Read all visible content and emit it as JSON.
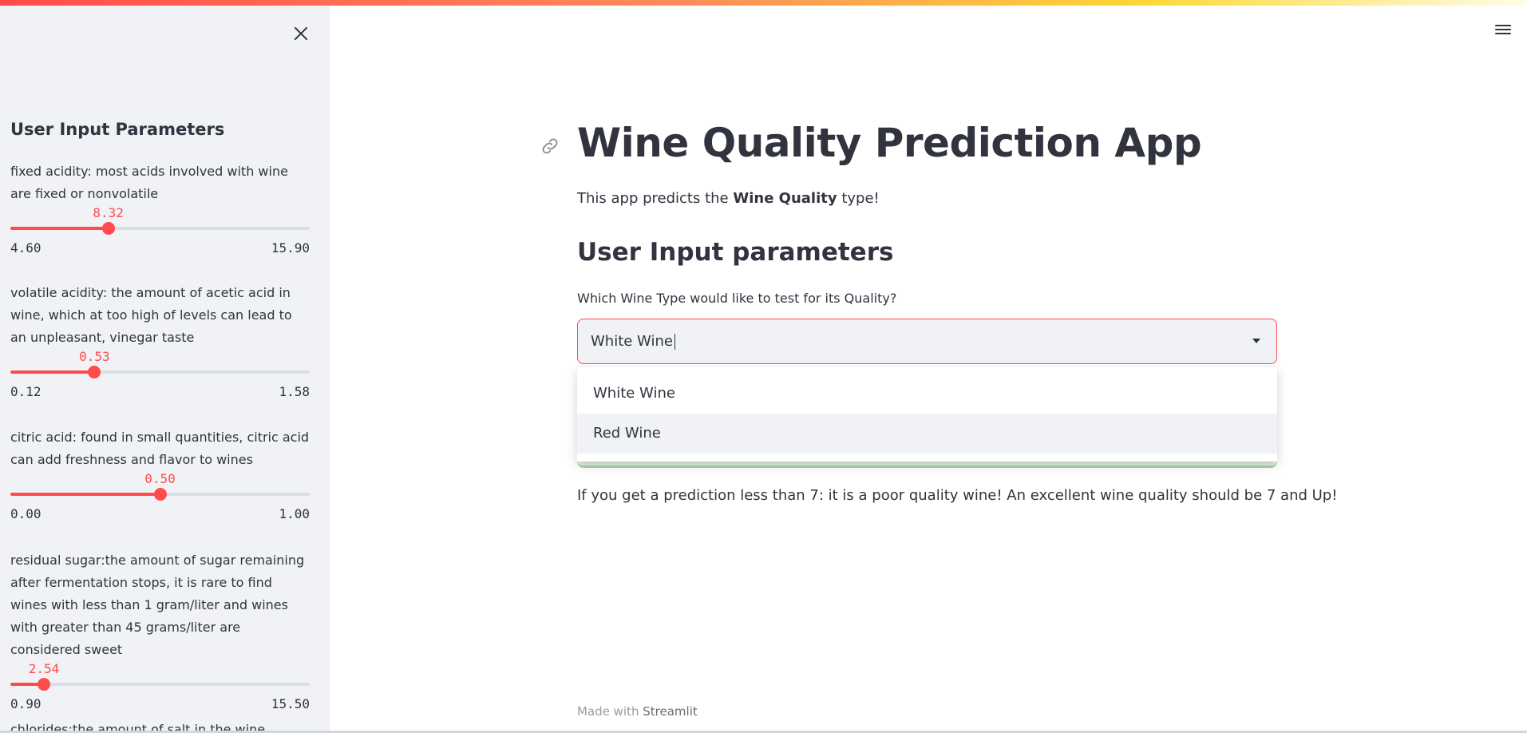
{
  "sidebar": {
    "title": "User Input Parameters",
    "params": [
      {
        "desc": "fixed acidity: most acids involved with wine are fixed or nonvolatile",
        "value": "8.32",
        "min": "4.60",
        "max": "15.90",
        "fraction": 0.327
      },
      {
        "desc": "volatile acidity: the amount of acetic acid in wine, which at too high of levels can lead to an unpleasant, vinegar taste",
        "value": "0.53",
        "min": "0.12",
        "max": "1.58",
        "fraction": 0.281
      },
      {
        "desc": "citric acid: found in small quantities, citric acid can add freshness and flavor to wines",
        "value": "0.50",
        "min": "0.00",
        "max": "1.00",
        "fraction": 0.5
      },
      {
        "desc": "residual sugar:the amount of sugar remaining after fermentation stops, it is rare to find wines with less than 1 gram/liter and wines with greater than 45 grams/liter are considered sweet",
        "value": "2.54",
        "min": "0.90",
        "max": "15.50",
        "fraction": 0.112
      },
      {
        "desc": "chlorides:the amount of salt in the wine"
      }
    ]
  },
  "main": {
    "title": "Wine Quality Prediction App",
    "intro_pre": "This app predicts the ",
    "intro_bold": "Wine Quality",
    "intro_post": " type!",
    "subtitle": "User Input parameters",
    "select_label": "Which Wine Type would like to test for its Quality?",
    "select_value": "White Wine",
    "options": [
      "White Wine",
      "Red Wine"
    ],
    "note": "If you get a prediction less than 7: it is a poor quality wine! An excellent wine quality should be 7 and Up!",
    "footer_pre": "Made with ",
    "footer_brand": "Streamlit"
  },
  "colors": {
    "accent": "#ff4b4b",
    "sidebar_bg": "#f0f2f6",
    "text": "#31333f"
  },
  "icons": {
    "close": "close-icon",
    "menu": "hamburger-menu-icon",
    "link": "link-icon",
    "dropdown": "chevron-down-icon"
  }
}
